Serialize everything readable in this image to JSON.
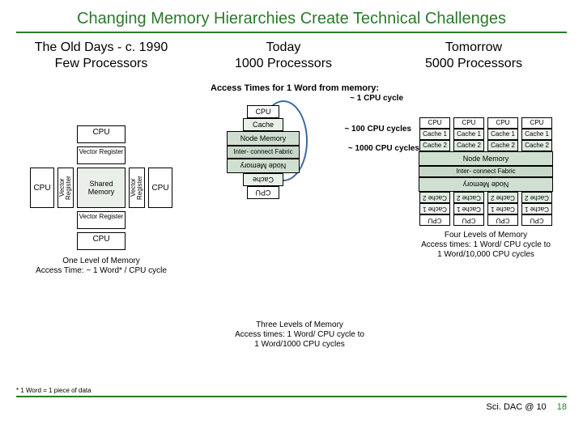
{
  "title": "Changing Memory Hierarchies Create Technical Challenges",
  "columns": {
    "old": {
      "head1": "The Old Days - c. 1990",
      "head2": "Few Processors"
    },
    "today": {
      "head1": "Today",
      "head2": "1000 Processors"
    },
    "tomorrow": {
      "head1": "Tomorrow",
      "head2": "5000 Processors"
    }
  },
  "old": {
    "cpu": "CPU",
    "vr": "Vector\nRegister",
    "sm": "Shared\nMemory",
    "caption1": "One Level of Memory",
    "caption2": "Access Time: ~ 1 Word* / CPU cycle"
  },
  "today": {
    "access_head": "Access Times for 1 Word from memory:",
    "cycle1": "~ 1 CPU cycle",
    "cycle2": "~ 100 CPU cycles",
    "cycle3": "~ 1000 CPU cycles",
    "cpu": "CPU",
    "cache": "Cache",
    "nm": "Node Memory",
    "ic": "Inter-\nconnect\nFabric",
    "caption1": "Three Levels of Memory",
    "caption2": "Access times: 1 Word/ CPU cycle to",
    "caption3": "1 Word/1000 CPU cycles"
  },
  "tomorrow": {
    "cpu": "CPU",
    "c1": "Cache\n1",
    "c2": "Cache\n2",
    "nm": "Node Memory",
    "ic": "Inter-\nconnect\nFabric",
    "caption1": "Four Levels of Memory",
    "caption2": "Access times: 1 Word/ CPU cycle to",
    "caption3": "1 Word/10,000 CPU cycles"
  },
  "footnote": "* 1 Word = 1 piece of data",
  "footer": {
    "conf": "Sci. DAC @ 10",
    "page": "18"
  }
}
